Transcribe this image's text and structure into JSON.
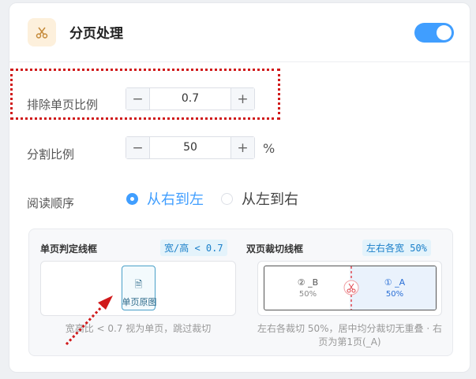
{
  "header": {
    "title": "分页处理",
    "icon": "scissors-icon",
    "toggle_on": true,
    "accent": "#409eff",
    "icon_color": "#c58a3a"
  },
  "exclude_ratio": {
    "label": "排除单页比例",
    "value": "0.7",
    "minus": "−",
    "plus": "+"
  },
  "split_ratio": {
    "label": "分割比例",
    "value": "50",
    "unit": "%",
    "minus": "−",
    "plus": "+"
  },
  "reading_order": {
    "label": "阅读顺序",
    "options": [
      {
        "label": "从右到左",
        "selected": true
      },
      {
        "label": "从左到右",
        "selected": false
      }
    ]
  },
  "single_page": {
    "title": "单页判定线框",
    "tag": "宽/高 < 0.7",
    "tile_label": "单页原图",
    "caption": "宽高比 < 0.7 视为单页，跳过裁切"
  },
  "double_page": {
    "title": "双页裁切线框",
    "tag": "左右各宽 50%",
    "left_label": "② _B",
    "left_pct": "50%",
    "right_label": "① _A",
    "right_pct": "50%",
    "caption_line1": "左右各裁切 50%，居中均分裁切无重叠 · 右",
    "caption_line2": "页为第1页(_A)"
  },
  "annotation_color": "#d0191a"
}
